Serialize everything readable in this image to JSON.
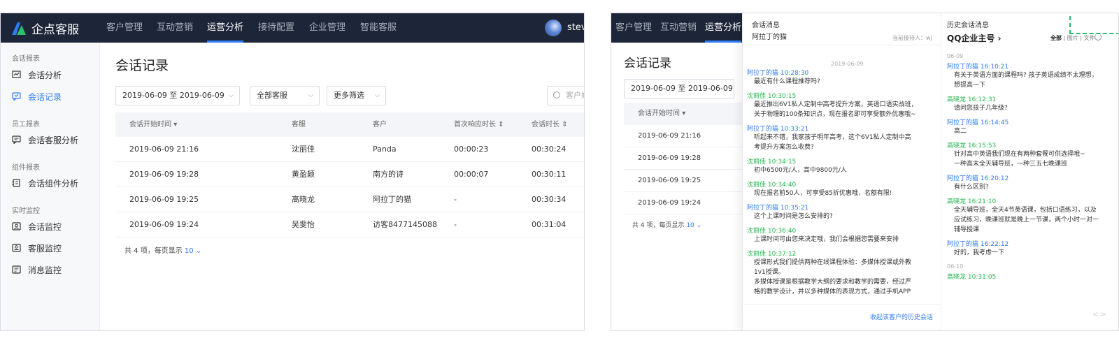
{
  "brand": {
    "name": "企点客服"
  },
  "nav": [
    "客户管理",
    "互动营销",
    "运营分析",
    "接待配置",
    "企业管理",
    "智能客服"
  ],
  "user": {
    "name": "steve"
  },
  "sidebar": {
    "groups": [
      "会话报表",
      "员工报表",
      "组件报表",
      "实时监控"
    ],
    "items": [
      "会话分析",
      "会话记录",
      "会话客服分析",
      "会话组件分析",
      "会话监控",
      "客服监控",
      "消息监控"
    ]
  },
  "page": {
    "title": "会话记录",
    "date_range": "2019-06-09 至 2019-06-09",
    "agent_filter": "全部客服",
    "more_filter": "更多筛选",
    "search_placeholder": "客户姓"
  },
  "table": {
    "headers": [
      "会话开始时间",
      "客服",
      "客户",
      "首次响应时长",
      "会话时长"
    ],
    "rows": [
      [
        "2019-06-09 21:16",
        "沈丽佳",
        "Panda",
        "00:00:23",
        "00:30:24"
      ],
      [
        "2019-06-09 19:28",
        "黄盈颖",
        "南方的诗",
        "00:00:07",
        "00:30:11"
      ],
      [
        "2019-06-09 19:25",
        "高晓龙",
        "阿拉丁的猫",
        "-",
        "00:30:34"
      ],
      [
        "2019-06-09 19:24",
        "吴斐怡",
        "访客8477145088",
        "-",
        "00:31:04"
      ]
    ],
    "footer_prefix": "共 4 项，每页显示",
    "page_size": "10"
  },
  "panel": {
    "left_title": "会话消息",
    "customer": "阿拉丁的猫",
    "receptionist": "当前接待人：wj",
    "date": "2019-06-09",
    "messages": [
      {
        "who": "c",
        "head": "阿拉丁的猫 10:28:30",
        "text": [
          "最近有什么课程推荐吗?"
        ]
      },
      {
        "who": "a",
        "head": "沈丽佳 10:30:15",
        "text": [
          "最近推出6V1私人定制中高考提升方案，英语口语实战班，",
          "关于物理的100条知识点，现在报名即可享受额外优惠哦~"
        ]
      },
      {
        "who": "c",
        "head": "阿拉丁的猫 10:33:21",
        "text": [
          "听起来不错，我家孩子明年高考，这个6V1私人定制中高",
          "考提升方案怎么收费?"
        ]
      },
      {
        "who": "a",
        "head": "沈丽佳 10:34:15",
        "text": [
          "初中6500元/人，高中9800元/人"
        ]
      },
      {
        "who": "a",
        "head": "沈丽佳 10:34:40",
        "text": [
          "现在报名前50人，可享受85折优惠哦，名额有限!"
        ]
      },
      {
        "who": "c",
        "head": "阿拉丁的猫 10:35:21",
        "text": [
          "这个上课时间是怎么安排的?"
        ]
      },
      {
        "who": "a",
        "head": "沈丽佳 10:36:40",
        "text": [
          "上课时间可由您来决定哦，我们会根据您需要来安排"
        ]
      },
      {
        "who": "a",
        "head": "沈丽佳 10:37:12",
        "text": [
          "授课形式我们提供两种在线课程体验：多媒体授课或外教",
          "1v1授课。",
          "多媒体授课是根据教学大纲的要求和教学的需要，经过严",
          "格的教学设计，并以多种媒体的表现方式，通过手机APP"
        ]
      }
    ],
    "history_link": "收起该客户的历史会话",
    "right_title": "历史会话消息",
    "account": "QQ企业主号",
    "filters": [
      "全部",
      "图片",
      "文件"
    ],
    "history_groups": [
      {
        "date": "06-09",
        "messages": [
          {
            "who": "c",
            "head": "阿拉丁的猫 16:10:21",
            "text": [
              "有关于英语方面的课程吗? 孩子英语成绩不太理想，",
              "想提高一下"
            ]
          },
          {
            "who": "a",
            "head": "高晓龙 16:12:31",
            "text": [
              "请问您孩子几年级?"
            ]
          },
          {
            "who": "c",
            "head": "阿拉丁的猫 16:14:45",
            "text": [
              "高二"
            ]
          },
          {
            "who": "a",
            "head": "高晓龙 16:15:53",
            "text": [
              "针对高中英语我们现在有两种套餐可供选择哦~",
              "一种高末全天辅导班，一种三五七晚课班"
            ]
          },
          {
            "who": "c",
            "head": "阿拉丁的猫 16:20:12",
            "text": [
              "有什么区别?"
            ]
          },
          {
            "who": "a",
            "head": "高晓龙 16:21:10",
            "text": [
              "全天辅导班，全天4节英语课，包括口语练习，以及",
              "应试练习，晚课班就是晚上一节课，两个小时一对一",
              "辅导授课"
            ]
          },
          {
            "who": "c",
            "head": "阿拉丁的猫 16:22:12",
            "text": [
              "好的，我考虑一下"
            ]
          }
        ]
      },
      {
        "date": "06-10",
        "messages": [
          {
            "who": "a",
            "head": "高晓龙 10:31:05",
            "text": []
          }
        ]
      }
    ],
    "pager": "< >"
  },
  "colors": {
    "accent": "#2d7cf6",
    "nav_bg": "#1d2538",
    "agent": "#1fb34a",
    "highlight": "#24c06a"
  }
}
